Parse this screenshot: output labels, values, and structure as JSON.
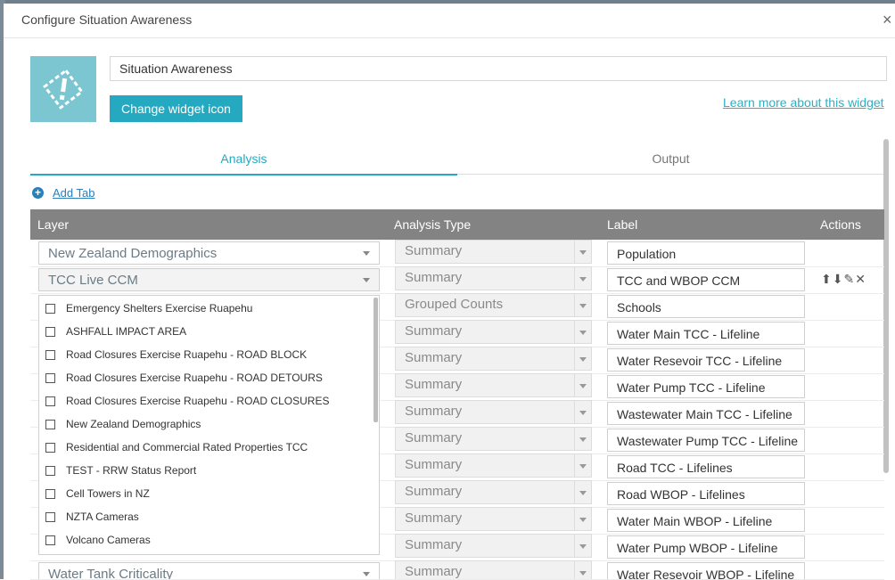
{
  "dialog": {
    "title": "Configure Situation Awareness",
    "close_glyph": "×"
  },
  "widget": {
    "icon": "situation-awareness-icon",
    "name_value": "Situation Awareness",
    "change_icon_label": "Change widget icon",
    "learn_more_label": "Learn more about this widget"
  },
  "tabs": [
    {
      "label": "Analysis",
      "active": true
    },
    {
      "label": "Output",
      "active": false
    }
  ],
  "add_tab_label": "Add Tab",
  "table": {
    "headers": {
      "layer": "Layer",
      "analysis_type": "Analysis Type",
      "label": "Label",
      "actions": "Actions"
    },
    "rows": [
      {
        "layer": "New Zealand Demographics",
        "analysis_type": "Summary",
        "label": "Population"
      },
      {
        "layer": "TCC Live CCM",
        "analysis_type": "Summary",
        "label": "TCC and WBOP CCM"
      },
      {
        "layer": "",
        "analysis_type": "Grouped Counts",
        "label": "Schools"
      },
      {
        "layer": "",
        "analysis_type": "Summary",
        "label": "Water Main TCC - Lifeline"
      },
      {
        "layer": "",
        "analysis_type": "Summary",
        "label": "Water Resevoir TCC - Lifeline"
      },
      {
        "layer": "",
        "analysis_type": "Summary",
        "label": "Water Pump TCC - Lifeline"
      },
      {
        "layer": "",
        "analysis_type": "Summary",
        "label": "Wastewater Main TCC - Lifeline"
      },
      {
        "layer": "",
        "analysis_type": "Summary",
        "label": "Wastewater Pump TCC - Lifeline"
      },
      {
        "layer": "",
        "analysis_type": "Summary",
        "label": "Road TCC - Lifelines"
      },
      {
        "layer": "",
        "analysis_type": "Summary",
        "label": "Road WBOP - Lifelines"
      },
      {
        "layer": "",
        "analysis_type": "Summary",
        "label": "Water Main WBOP - Lifeline"
      },
      {
        "layer": "",
        "analysis_type": "Summary",
        "label": "Water Pump WBOP - Lifeline"
      },
      {
        "layer": "Water Tank Criticality",
        "analysis_type": "Summary",
        "label": "Water Resevoir WBOP - Lifeline"
      }
    ],
    "action_icons": [
      "arrow-up-icon",
      "arrow-down-icon",
      "pencil-icon",
      "delete-x-icon"
    ]
  },
  "dropdown_options": [
    {
      "label": "Emergency Shelters Exercise Ruapehu",
      "icon": "point-layer-icon"
    },
    {
      "label": "ASHFALL IMPACT AREA",
      "icon": "polygon-layer-icon"
    },
    {
      "label": "Road Closures Exercise Ruapehu - ROAD BLOCK",
      "icon": "point-layer-icon"
    },
    {
      "label": "Road Closures Exercise Ruapehu - ROAD DETOURS",
      "icon": "line-layer-icon"
    },
    {
      "label": "Road Closures Exercise Ruapehu - ROAD CLOSURES",
      "icon": "line-layer-icon"
    },
    {
      "label": "New Zealand Demographics",
      "icon": "polygon-layer-icon"
    },
    {
      "label": "Residential and Commercial Rated Properties TCC",
      "icon": "polygon-layer-icon"
    },
    {
      "label": "TEST - RRW Status Report",
      "icon": "point-layer-icon"
    },
    {
      "label": "Cell Towers in NZ",
      "icon": "point-layer-icon"
    },
    {
      "label": "NZTA Cameras",
      "icon": "point-layer-icon"
    },
    {
      "label": "Volcano Cameras",
      "icon": "point-layer-icon"
    }
  ],
  "colors": {
    "accent": "#24a9c0",
    "header_bg": "#838383",
    "icon_bg": "#7cc6d2",
    "link": "#2b7fb9"
  }
}
